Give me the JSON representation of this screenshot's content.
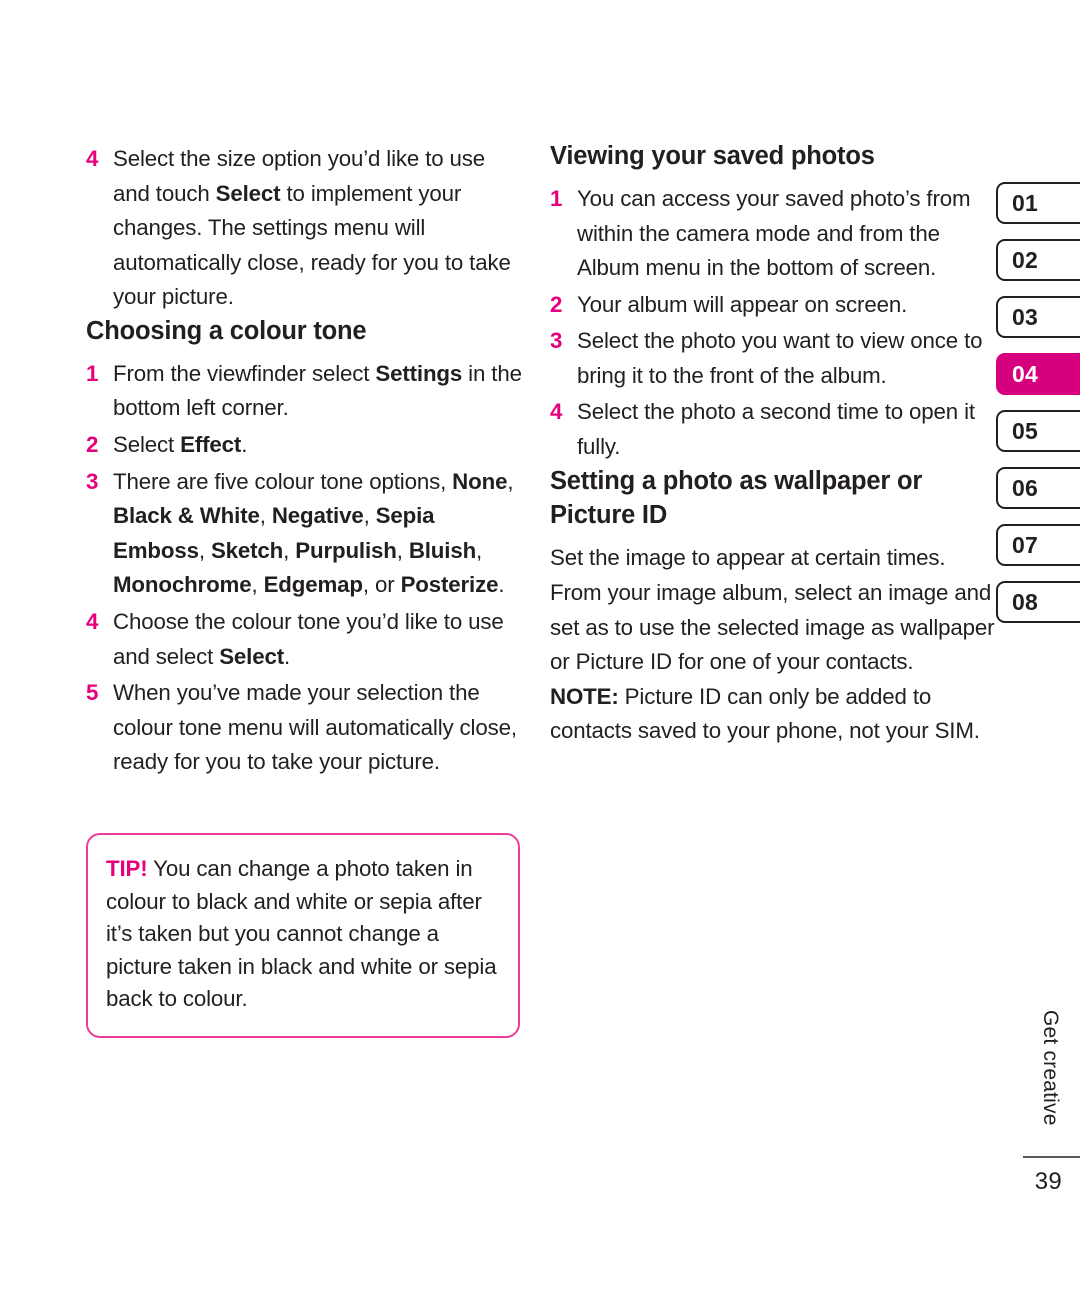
{
  "colors": {
    "accent_pink": "#e6007e",
    "tab_active": "#d6007f",
    "tip_border": "#ee3d96",
    "text": "#231f20",
    "rule": "#58595b"
  },
  "left_column": {
    "step4_camera_size": {
      "number": "4",
      "parts": [
        "Select the size option you’d like to use and touch ",
        "Select",
        " to implement your changes. The settings menu will automatically close, ready for you to take your picture."
      ]
    },
    "heading_colour_tone": "Choosing a colour tone",
    "steps": [
      {
        "number": "1",
        "parts": [
          "From the viewfinder select ",
          "Settings",
          " in the bottom left corner."
        ]
      },
      {
        "number": "2",
        "parts": [
          "Select ",
          "Effect",
          "."
        ]
      },
      {
        "number": "3",
        "parts": [
          "There are five colour tone options, ",
          "None",
          ", ",
          "Black & White",
          ", ",
          "Negative",
          ", ",
          "Sepia Emboss",
          ", ",
          "Sketch",
          ", ",
          "Purpulish",
          ", ",
          "Bluish",
          ", ",
          "Monochrome",
          ", ",
          "Edgemap",
          ", or ",
          "Posterize",
          "."
        ]
      },
      {
        "number": "4",
        "parts": [
          "Choose the colour tone you’d like to use and select ",
          "Select",
          "."
        ]
      },
      {
        "number": "5",
        "parts": [
          "When you’ve made your selection the colour tone menu will automatically close, ready for you to take your picture."
        ]
      }
    ],
    "tip": {
      "label": "TIP!",
      "body": " You can change a photo taken in colour to black and white or sepia after it’s taken but you cannot change a picture taken in black and white or sepia back to colour."
    }
  },
  "right_column": {
    "heading_viewing": "Viewing your saved photos",
    "viewing_steps": [
      {
        "number": "1",
        "text": "You can access your saved photo’s from within the camera mode and from the Album menu in the bottom of screen."
      },
      {
        "number": "2",
        "text": "Your album will appear on screen."
      },
      {
        "number": "3",
        "text": "Select the photo you want to view once to bring it to the front of the album."
      },
      {
        "number": "4",
        "text": "Select the photo a second time to open it fully."
      }
    ],
    "heading_wallpaper": "Setting a photo as wallpaper or Picture ID",
    "wallpaper_body": "Set the image to appear at certain times. From your image album, select an image and set as to use the selected image as wallpaper or Picture ID for one of your contacts.",
    "note": {
      "label": "NOTE:",
      "body": " Picture ID can only be added to contacts saved to your phone, not your SIM."
    }
  },
  "index_tabs": [
    {
      "label": "01",
      "active": false
    },
    {
      "label": "02",
      "active": false
    },
    {
      "label": "03",
      "active": false
    },
    {
      "label": "04",
      "active": true
    },
    {
      "label": "05",
      "active": false
    },
    {
      "label": "06",
      "active": false
    },
    {
      "label": "07",
      "active": false
    },
    {
      "label": "08",
      "active": false
    }
  ],
  "running_head": "Get creative",
  "page_number": "39"
}
